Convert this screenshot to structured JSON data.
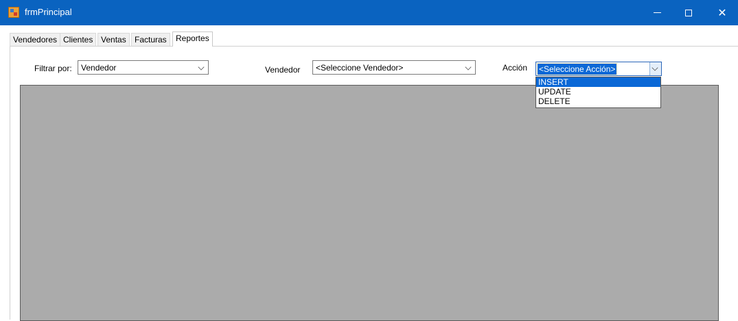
{
  "window": {
    "title": "frmPrincipal",
    "icon": "application-icon",
    "controls": [
      "minimize-icon",
      "maximize-icon",
      "close-icon"
    ],
    "close_glyph": "✕",
    "accent_color": "#0a63c0"
  },
  "tabs": [
    {
      "label": "Vendedores",
      "active": false
    },
    {
      "label": "Clientes",
      "active": false
    },
    {
      "label": "Ventas",
      "active": false
    },
    {
      "label": "Facturas",
      "active": false
    },
    {
      "label": "Reportes",
      "active": true
    }
  ],
  "filters": {
    "filtrar_label": "Filtrar por:",
    "filtrar_value": "Vendedor",
    "vendedor_label": "Vendedor",
    "vendedor_value": "<Seleccione Vendedor>",
    "accion_label": "Acción",
    "accion_value": "<Seleccione Acción>"
  },
  "accion_dropdown": {
    "open": true,
    "options": [
      "INSERT",
      "UPDATE",
      "DELETE"
    ],
    "highlighted": "INSERT"
  },
  "grid": {
    "background_color": "#ababab",
    "rows": []
  }
}
